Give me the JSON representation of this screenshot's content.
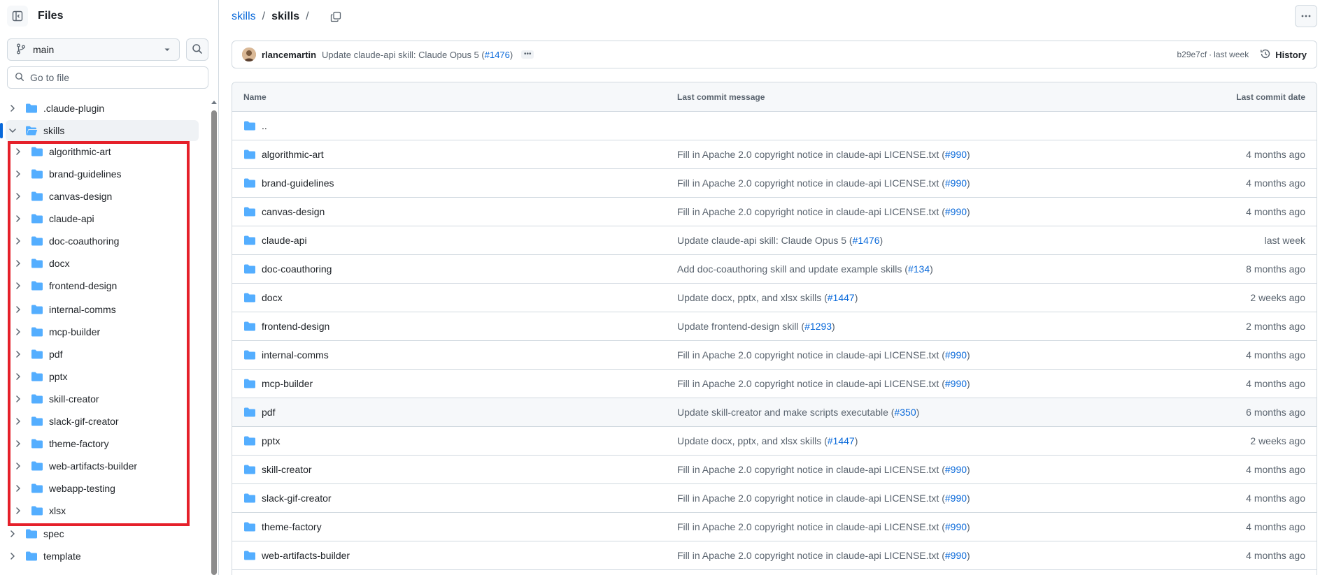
{
  "sidebar": {
    "title": "Files",
    "branch": "main",
    "goto_placeholder": "Go to file",
    "tree": [
      {
        "name": ".claude-plugin",
        "level": 0,
        "expanded": false,
        "selected": false
      },
      {
        "name": "skills",
        "level": 0,
        "expanded": true,
        "selected": true
      },
      {
        "name": "algorithmic-art",
        "level": 1,
        "expanded": false,
        "selected": false
      },
      {
        "name": "brand-guidelines",
        "level": 1,
        "expanded": false,
        "selected": false
      },
      {
        "name": "canvas-design",
        "level": 1,
        "expanded": false,
        "selected": false
      },
      {
        "name": "claude-api",
        "level": 1,
        "expanded": false,
        "selected": false
      },
      {
        "name": "doc-coauthoring",
        "level": 1,
        "expanded": false,
        "selected": false
      },
      {
        "name": "docx",
        "level": 1,
        "expanded": false,
        "selected": false
      },
      {
        "name": "frontend-design",
        "level": 1,
        "expanded": false,
        "selected": false
      },
      {
        "name": "internal-comms",
        "level": 1,
        "expanded": false,
        "selected": false
      },
      {
        "name": "mcp-builder",
        "level": 1,
        "expanded": false,
        "selected": false
      },
      {
        "name": "pdf",
        "level": 1,
        "expanded": false,
        "selected": false
      },
      {
        "name": "pptx",
        "level": 1,
        "expanded": false,
        "selected": false
      },
      {
        "name": "skill-creator",
        "level": 1,
        "expanded": false,
        "selected": false
      },
      {
        "name": "slack-gif-creator",
        "level": 1,
        "expanded": false,
        "selected": false
      },
      {
        "name": "theme-factory",
        "level": 1,
        "expanded": false,
        "selected": false
      },
      {
        "name": "web-artifacts-builder",
        "level": 1,
        "expanded": false,
        "selected": false
      },
      {
        "name": "webapp-testing",
        "level": 1,
        "expanded": false,
        "selected": false
      },
      {
        "name": "xlsx",
        "level": 1,
        "expanded": false,
        "selected": false
      },
      {
        "name": "spec",
        "level": 0,
        "expanded": false,
        "selected": false
      },
      {
        "name": "template",
        "level": 0,
        "expanded": false,
        "selected": false
      }
    ]
  },
  "breadcrumb": {
    "root": "skills",
    "separator": "/",
    "current": "skills",
    "trailing": "/"
  },
  "latest_commit": {
    "author": "rlancemartin",
    "message": "Update claude-api skill: Claude Opus 5 (",
    "pr": "#1476",
    "message_end": ")",
    "sha": "b29e7cf",
    "dot": "·",
    "time": "last week",
    "history_label": "History"
  },
  "table": {
    "headers": {
      "name": "Name",
      "message": "Last commit message",
      "date": "Last commit date"
    },
    "parent": "..",
    "rows": [
      {
        "name": "algorithmic-art",
        "msg": "Fill in Apache 2.0 copyright notice in claude-api LICENSE.txt (",
        "pr": "#990",
        "end": ")",
        "date": "4 months ago"
      },
      {
        "name": "brand-guidelines",
        "msg": "Fill in Apache 2.0 copyright notice in claude-api LICENSE.txt (",
        "pr": "#990",
        "end": ")",
        "date": "4 months ago"
      },
      {
        "name": "canvas-design",
        "msg": "Fill in Apache 2.0 copyright notice in claude-api LICENSE.txt (",
        "pr": "#990",
        "end": ")",
        "date": "4 months ago"
      },
      {
        "name": "claude-api",
        "msg": "Update claude-api skill: Claude Opus 5 (",
        "pr": "#1476",
        "end": ")",
        "date": "last week"
      },
      {
        "name": "doc-coauthoring",
        "msg": "Add doc-coauthoring skill and update example skills (",
        "pr": "#134",
        "end": ")",
        "date": "8 months ago"
      },
      {
        "name": "docx",
        "msg": "Update docx, pptx, and xlsx skills (",
        "pr": "#1447",
        "end": ")",
        "date": "2 weeks ago"
      },
      {
        "name": "frontend-design",
        "msg": "Update frontend-design skill (",
        "pr": "#1293",
        "end": ")",
        "date": "2 months ago"
      },
      {
        "name": "internal-comms",
        "msg": "Fill in Apache 2.0 copyright notice in claude-api LICENSE.txt (",
        "pr": "#990",
        "end": ")",
        "date": "4 months ago"
      },
      {
        "name": "mcp-builder",
        "msg": "Fill in Apache 2.0 copyright notice in claude-api LICENSE.txt (",
        "pr": "#990",
        "end": ")",
        "date": "4 months ago"
      },
      {
        "name": "pdf",
        "msg": "Update skill-creator and make scripts executable (",
        "pr": "#350",
        "end": ")",
        "date": "6 months ago",
        "hover": true
      },
      {
        "name": "pptx",
        "msg": "Update docx, pptx, and xlsx skills (",
        "pr": "#1447",
        "end": ")",
        "date": "2 weeks ago"
      },
      {
        "name": "skill-creator",
        "msg": "Fill in Apache 2.0 copyright notice in claude-api LICENSE.txt (",
        "pr": "#990",
        "end": ")",
        "date": "4 months ago"
      },
      {
        "name": "slack-gif-creator",
        "msg": "Fill in Apache 2.0 copyright notice in claude-api LICENSE.txt (",
        "pr": "#990",
        "end": ")",
        "date": "4 months ago"
      },
      {
        "name": "theme-factory",
        "msg": "Fill in Apache 2.0 copyright notice in claude-api LICENSE.txt (",
        "pr": "#990",
        "end": ")",
        "date": "4 months ago"
      },
      {
        "name": "web-artifacts-builder",
        "msg": "Fill in Apache 2.0 copyright notice in claude-api LICENSE.txt (",
        "pr": "#990",
        "end": ")",
        "date": "4 months ago"
      }
    ]
  },
  "colors": {
    "accent": "#0969da",
    "folder": "#54aeff",
    "highlight": "#e5202a"
  },
  "icons": {
    "sidebar_toggle": "sidebar-collapse-icon",
    "branch": "git-branch-icon",
    "caret": "triangle-down-icon",
    "search": "search-icon",
    "copy": "copy-icon",
    "more": "kebab-horizontal-icon",
    "history": "history-icon",
    "folder": "folder-icon"
  }
}
